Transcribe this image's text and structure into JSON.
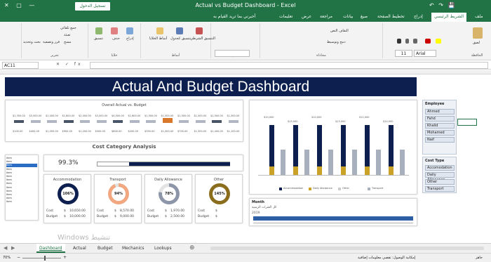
{
  "titlebar": {
    "title": "Actual vs Budget Dashboard - Excel",
    "signin": "تسجيل الدخول",
    "window_controls": "✕ ▢ —",
    "qat": "↶ ↷ 💾"
  },
  "menu_tabs": [
    "ملف",
    "الشريط الرئيسي",
    "إدراج",
    "تخطيط الصفحة",
    "صيغ",
    "بيانات",
    "مراجعة",
    "عرض",
    "تعليمات",
    "أخبرني بما تريد القيام به"
  ],
  "ribbon": {
    "font_name": "Arial",
    "font_size": "11",
    "labels": {
      "paste": "لصق",
      "clipboard": "الحافظة",
      "font": "خط",
      "alignment": "محاذاة",
      "number": "رقم",
      "styles": "أنماط",
      "cells": "خلايا",
      "editing": "تحرير",
      "wrap": "التفاف النص",
      "merge": "دمج وتوسيط",
      "cond": "التنسيق الشرطي",
      "table": "تنسيق كجدول",
      "cellstyles": "أنماط الخلايا",
      "insert": "إدراج",
      "delete": "حذف",
      "format": "تنسيق",
      "sum": "جمع تلقائي",
      "fill": "تعبئة",
      "clear": "مسح",
      "sort": "فرز وتصفية",
      "find": "بحث وتحديد"
    }
  },
  "formula": {
    "namebox": "AC11",
    "fx": "✕ ✓ fx"
  },
  "dashboard": {
    "banner": "Actual And Budget  Dashboard",
    "overall": {
      "title": "Overall Actual vs. Budget",
      "top_labels": [
        "$1,350.00",
        "$5,000.00",
        "$1,000.00",
        "$1,800.00",
        "$2,000.00",
        "$3,000.00",
        "$4,500.00",
        "$1,600.00",
        "$1,500.00",
        "$1,500.00",
        "$1,500.00",
        "$1,500.00",
        "$1,500.00",
        "$1,500.00"
      ],
      "bottom_labels": [
        "$100.00",
        "$400.00",
        "$1,050.00",
        "$900.00",
        "$1,200.00",
        "$500.00",
        "$800.00",
        "$200.00",
        "$350.00",
        "$1,000.00",
        "$700.00",
        "$1,300.00",
        "$1,400.00",
        "$1,100.00"
      ]
    },
    "cost_title": "Cost Category Analysis",
    "percent": "99.3%",
    "kpis": [
      {
        "name": "Accommodation",
        "pct": "106%",
        "actual": "10,650.00",
        "budget": "10,000.00",
        "color": "#0c1f4e"
      },
      {
        "name": "Transport",
        "pct": "94%",
        "actual": "8,570.00",
        "budget": "9,000.00",
        "color": "#f1a77f"
      },
      {
        "name": "Daily Allowance",
        "pct": "78%",
        "actual": "1,970.00",
        "budget": "2,500.00",
        "color": "#8c96a8"
      },
      {
        "name": "Other",
        "pct": "145%",
        "actual": "",
        "budget": "",
        "color": "#8a6d1d"
      }
    ],
    "cost_labels": {
      "actual": "Cost",
      "budget": "Budget",
      "currency": "$"
    },
    "list_items": [
      "Item",
      "Item",
      "Item",
      "Item",
      "Item",
      "Item",
      "Item",
      "Item",
      "Item",
      "Item",
      "Item",
      "Item",
      "Item"
    ],
    "emp_chart": {
      "top_labels": [
        "$10,000",
        "$15,000",
        "$10,000",
        "$13,000",
        "$12,000",
        "$14,000"
      ],
      "legend": [
        "Accommodation",
        "Daily Allowance",
        "Other",
        "Transport"
      ]
    },
    "month_panel": {
      "title": "Month",
      "subtitle": "كل الفترات الزمنية",
      "year": "2019"
    },
    "employee_slicer": {
      "title": "Employee",
      "items": [
        "Ahmed",
        "Fahd",
        "Khalid",
        "Mohamed",
        "Naif"
      ]
    },
    "costtype_slicer": {
      "title": "Cost Type",
      "items": [
        "Accomodation",
        "Daily Allowance",
        "Other",
        "Transport"
      ]
    }
  },
  "sheets": [
    "Dashboard",
    "Actual",
    "Budget",
    "Mechanics",
    "Lookups"
  ],
  "watermark": "Windows تنشيط",
  "status": {
    "ready": "جاهز",
    "zoom": "70%",
    "accessibility": "إمكانية الوصول: تقصي معلومات إضافية"
  },
  "colors": {
    "excel_green": "#217346",
    "navy": "#0c1f4e",
    "gold": "#c9a227",
    "grey": "#a8b0bd",
    "orange": "#d9772b"
  }
}
